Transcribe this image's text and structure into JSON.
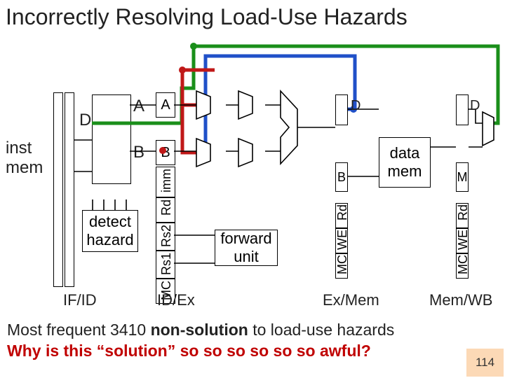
{
  "title": "Incorrectly Resolving Load-Use Hazards",
  "inst_mem": "inst\nmem",
  "detect": "detect\nhazard",
  "forward": "forward\nunit",
  "data_mem": "data\nmem",
  "labels": {
    "A1": "A",
    "A2": "A",
    "B1": "B",
    "B2": "B",
    "B3": "B",
    "D1": "D",
    "D2": "D",
    "D3": "D",
    "M": "M"
  },
  "pipe": {
    "imm": "imm",
    "rd": "Rd",
    "rs2": "Rs2",
    "rs1": "Rs1",
    "mc": "MC",
    "rd2": "Rd",
    "we": "WE",
    "mc2": "MC",
    "rd3": "Rd",
    "we2": "WE",
    "mc3": "MC"
  },
  "stages": {
    "ifid": "IF/ID",
    "idex": "ID/Ex",
    "exmem": "Ex/Mem",
    "memwb": "Mem/WB"
  },
  "footer1_a": "Most frequent 3410 ",
  "footer1_b": "non-solution",
  "footer1_c": " to load-use hazards",
  "footer2": "Why is this “solution” so so so so so so awful?",
  "page": "114"
}
